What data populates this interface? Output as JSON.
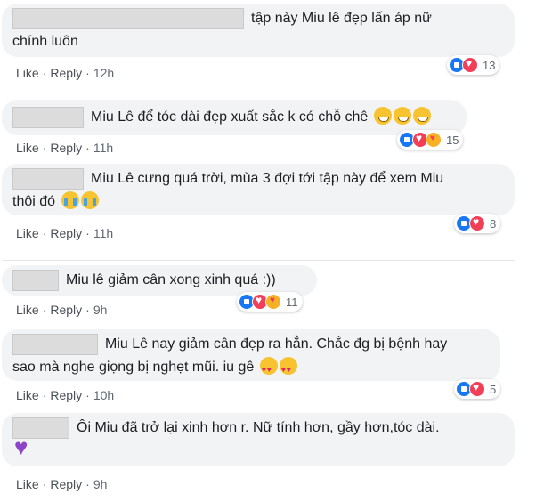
{
  "actions": {
    "like": "Like",
    "reply": "Reply"
  },
  "comments": [
    {
      "lines": [
        "tập này Miu lê đẹp lấn áp nữ",
        "chính luôn"
      ],
      "time": "12h",
      "reactions": [
        "like",
        "love"
      ],
      "count": "13"
    },
    {
      "lines": [
        "Miu Lê để tóc dài đẹp xuất sắc k có chỗ chê"
      ],
      "time": "11h",
      "reactions": [
        "like",
        "love",
        "care"
      ],
      "count": "15"
    },
    {
      "lines": [
        "Miu Lê cưng quá trời, mùa 3 đợi tới tập này để xem Miu",
        "thôi đó"
      ],
      "time": "11h",
      "reactions": [
        "like",
        "love"
      ],
      "count": "8"
    },
    {
      "lines": [
        "Miu lê giảm cân xong xinh quá :))"
      ],
      "time": "9h",
      "reactions": [
        "like",
        "love",
        "care"
      ],
      "count": "11"
    },
    {
      "lines": [
        "Miu Lê nay giảm cân đẹp ra hẳn. Chắc đg bị bệnh hay",
        "sao mà nghe giọng bị nghẹt mũi. iu gê"
      ],
      "time": "10h",
      "reactions": [
        "like",
        "love"
      ],
      "count": "5"
    },
    {
      "lines": [
        "Ôi Miu đã trở lại xinh hơn r. Nữ tính hơn, gầy hơn,tóc dài."
      ],
      "time": "9h",
      "reactions": [],
      "count": ""
    }
  ],
  "emoji_names": [
    "grinning-emoji",
    "crying-emoji",
    "heart-eyes-emoji",
    "purple-heart-emoji"
  ]
}
